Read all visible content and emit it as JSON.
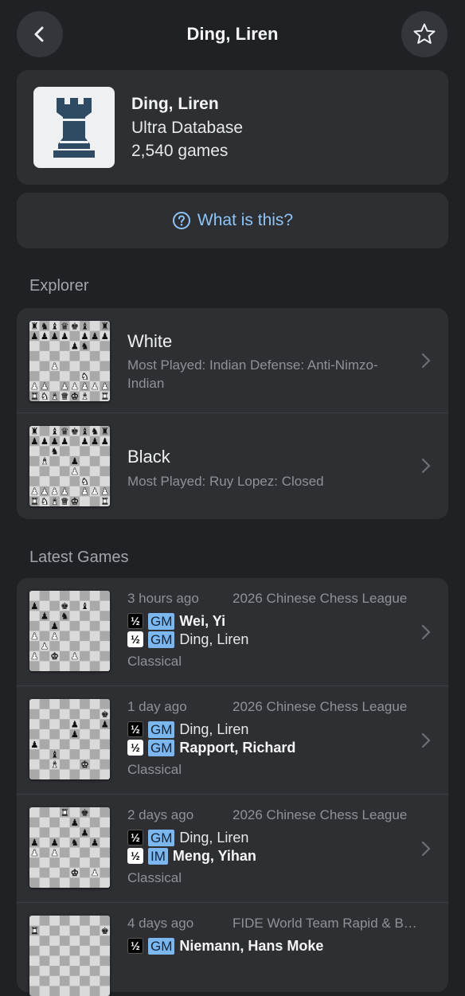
{
  "header": {
    "title": "Ding, Liren",
    "back_icon": "chevron-left-icon",
    "favorite_icon": "star-outline-icon"
  },
  "profile": {
    "name": "Ding, Liren",
    "database": "Ultra Database",
    "games_count": "2,540 games",
    "logo_icon": "rook-icon"
  },
  "help_link": {
    "label": "What is this?",
    "icon": "question-circle-icon",
    "color": "#8ec4f6"
  },
  "explorer": {
    "section_title": "Explorer",
    "items": [
      {
        "title": "White",
        "subtitle": "Most Played: Indian Defense: Anti-Nimzo-Indian"
      },
      {
        "title": "Black",
        "subtitle": "Most Played: Ruy Lopez: Closed"
      }
    ]
  },
  "latest_games": {
    "section_title": "Latest Games",
    "items": [
      {
        "time": "3 hours ago",
        "event": "2026 Chinese Chess League",
        "p1": {
          "result": "½",
          "title": "GM",
          "name": "Wei, Yi"
        },
        "p2": {
          "result": "½",
          "title": "GM",
          "name": "Ding, Liren"
        },
        "time_control": "Classical"
      },
      {
        "time": "1 day ago",
        "event": "2026 Chinese Chess League",
        "p1": {
          "result": "½",
          "title": "GM",
          "name": "Ding, Liren"
        },
        "p2": {
          "result": "½",
          "title": "GM",
          "name": "Rapport, Richard"
        },
        "time_control": "Classical"
      },
      {
        "time": "2 days ago",
        "event": "2026 Chinese Chess League",
        "p1": {
          "result": "½",
          "title": "GM",
          "name": "Ding, Liren"
        },
        "p2": {
          "result": "½",
          "title": "IM",
          "name": "Meng, Yihan"
        },
        "time_control": "Classical"
      },
      {
        "time": "4 days ago",
        "event": "FIDE World Team Rapid & Blitz",
        "p1": {
          "result": "½",
          "title": "GM",
          "name": "Niemann, Hans Moke"
        }
      }
    ]
  },
  "colors": {
    "background": "#1f2125",
    "card": "#2d2f33",
    "badge": "#7db7ef",
    "board_light": "#dadada",
    "board_dark": "#a9a9a9",
    "board_highlight": "#cfc98a"
  }
}
